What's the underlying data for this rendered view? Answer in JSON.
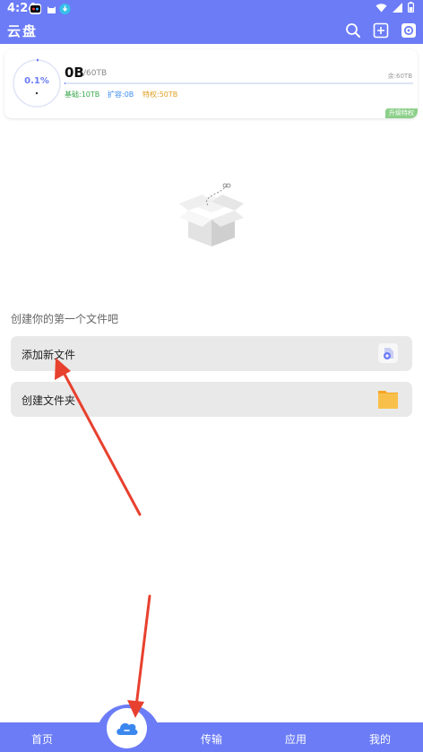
{
  "status_bar": {
    "time": "4:24"
  },
  "app_bar": {
    "title": "云盘",
    "icons": [
      "search-icon",
      "add-icon",
      "settings-icon"
    ]
  },
  "storage": {
    "used": "0B",
    "total": "/60TB",
    "remaining": "余:60TB",
    "percent_label": "0.1%",
    "percent_value": 0.1,
    "basic": "基础:10TB",
    "expanded": "扩容:0B",
    "privilege": "特权:50TB",
    "upgrade_label": "升级特权"
  },
  "empty_state": {
    "prompt": "创建你的第一个文件吧"
  },
  "actions": [
    {
      "label": "添加新文件",
      "icon": "add-file-icon"
    },
    {
      "label": "创建文件夹",
      "icon": "folder-icon"
    }
  ],
  "bottom_nav": {
    "items": [
      "首页",
      "传输",
      "应用",
      "我的"
    ],
    "center_icon": "cloud-icon"
  },
  "colors": {
    "primary": "#6b7cf6",
    "basic": "#3aa84f",
    "expanded": "#3b8cf0",
    "privilege": "#e0a020",
    "arrow": "#e8402e"
  }
}
